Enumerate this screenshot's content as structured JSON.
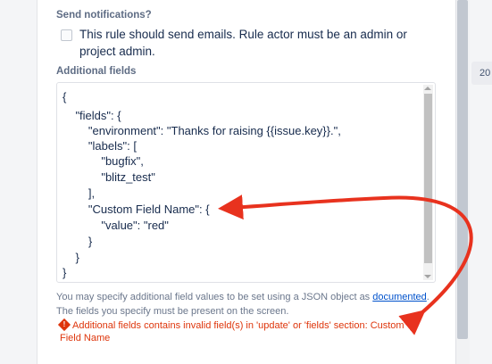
{
  "notifications": {
    "label": "Send notifications?",
    "checkbox_text": "This rule should send emails. Rule actor must be an admin or project admin.",
    "checked": false
  },
  "additional_fields": {
    "label": "Additional fields",
    "code_lines": [
      "{",
      "    \"fields\": {",
      "        \"environment\": \"Thanks for raising {{issue.key}}.\",",
      "        \"labels\": [",
      "            \"bugfix\",",
      "            \"blitz_test\"",
      "        ],",
      "        \"Custom Field Name\": {",
      "            \"value\": \"red\"",
      "        }",
      "    }",
      "}"
    ]
  },
  "help": {
    "text_before": "You may specify additional field values to be set using a JSON object as ",
    "link": "documented",
    "text_after": ". The fields you specify must be present on the screen."
  },
  "error": {
    "icon": "error-diamond-icon",
    "text": "Additional fields contains invalid field(s) in 'update' or 'fields' section: Custom Field Name"
  },
  "right_tab": {
    "text": "20"
  },
  "annotations": {
    "arrow_color": "#e8321e"
  }
}
